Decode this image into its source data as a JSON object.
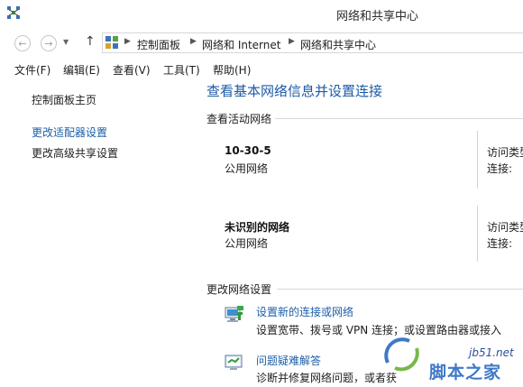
{
  "window": {
    "title": "网络和共享中心"
  },
  "address_bar": {
    "breadcrumbs": [
      "控制面板",
      "网络和 Internet",
      "网络和共享中心"
    ]
  },
  "menu": [
    "文件(F)",
    "编辑(E)",
    "查看(V)",
    "工具(T)",
    "帮助(H)"
  ],
  "sidebar": {
    "items": [
      {
        "label": "控制面板主页"
      },
      {
        "label": "更改适配器设置"
      },
      {
        "label": "更改高级共享设置"
      }
    ]
  },
  "main": {
    "title": "查看基本网络信息并设置连接",
    "active_section": "查看活动网络",
    "networks": [
      {
        "name": "10-30-5",
        "type": "公用网络",
        "access_label": "访问类型",
        "connection_label": "连接:"
      },
      {
        "name": "未识别的网络",
        "type": "公用网络",
        "access_label": "访问类型",
        "connection_label": "连接:"
      }
    ],
    "change_section": "更改网络设置",
    "tasks": [
      {
        "link": "设置新的连接或网络",
        "desc": "设置宽带、拨号或 VPN 连接；或设置路由器或接入",
        "icon": "network-setup-icon"
      },
      {
        "link": "问题疑难解答",
        "desc": "诊断并修复网络问题，或者获",
        "icon": "troubleshoot-icon"
      }
    ]
  },
  "watermark": {
    "site": "jb51.net",
    "name": "脚本之家"
  }
}
